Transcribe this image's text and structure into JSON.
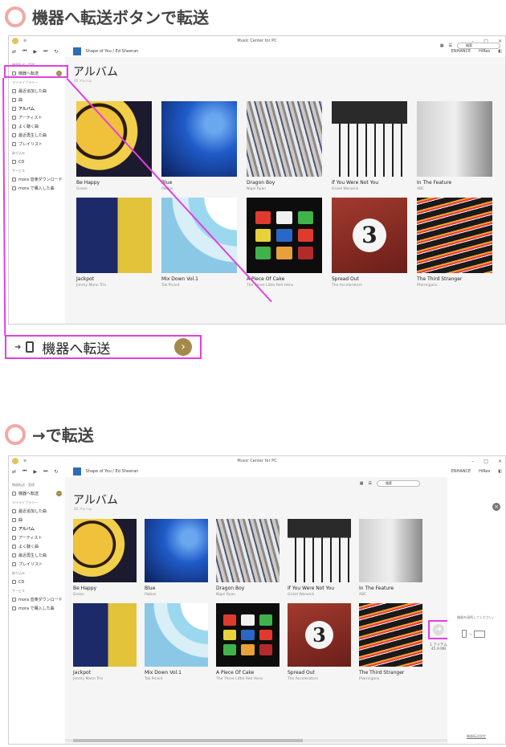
{
  "section1": {
    "title": "機器へ転送ボタンで転送"
  },
  "section2": {
    "title": "→で転送"
  },
  "app": {
    "window_title": "Music Center for PC",
    "now_playing": "Shape of You / Ed Sheeran",
    "toolbar_right": [
      "ENHANCE",
      "HiRes"
    ],
    "search_placeholder": "検索"
  },
  "sidebar": {
    "group_device": "機器転送・管理",
    "transfer_label": "機器へ転送",
    "group_library": "マイライブラリー",
    "items": [
      "最近追加した曲",
      "曲",
      "アルバム",
      "アーティスト",
      "よく聴く曲",
      "最近再生した曲",
      "プレイリスト"
    ],
    "group_import": "取り込み",
    "import_items": [
      "CD"
    ],
    "group_services": "サービス",
    "service_items": [
      "mora 音楽ダウンロード",
      "mora で購入した曲"
    ]
  },
  "main": {
    "title": "アルバム",
    "count": "20 アルバム"
  },
  "albums": [
    {
      "title": "Be Happy",
      "artist": "Grean"
    },
    {
      "title": "Blue",
      "artist": "Pablos"
    },
    {
      "title": "Dragon Boy",
      "artist": "Nigel Ryan"
    },
    {
      "title": "If You Were Not You",
      "artist": "Grizel Warwick"
    },
    {
      "title": "In The Feature",
      "artist": "ABC"
    },
    {
      "title": "Jackpot",
      "artist": "Jimmy Mann Trio"
    },
    {
      "title": "Mix Down Vol.1",
      "artist": "Tak Picard"
    },
    {
      "title": "A Piece Of Cake",
      "artist": "The Three Little Red Hens"
    },
    {
      "title": "Spread Out",
      "artist": "The Accelerators"
    },
    {
      "title": "The Third Stranger",
      "artist": "Ptarmigans"
    }
  ],
  "zoom_label": "機器へ転送",
  "transfer_panel": {
    "message": "機器を接続してください。",
    "items": "1 アイテム",
    "size": "45.9 MB",
    "link": "機器転送設定"
  },
  "colors": {
    "accent_pink": "#e040e0",
    "transfer_gold": "#a48a4a",
    "ring": "#f3a8a4"
  }
}
